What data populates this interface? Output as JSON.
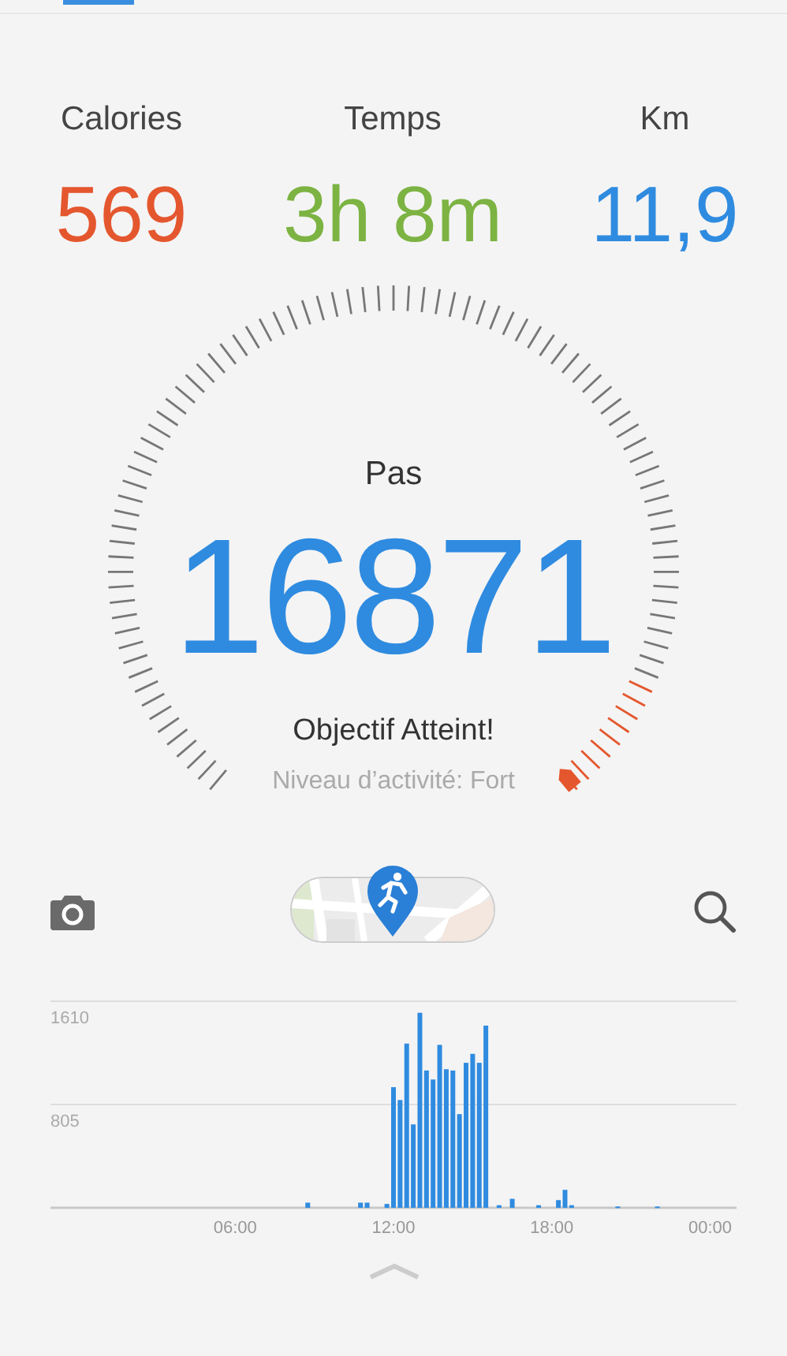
{
  "stats": [
    {
      "label": "Calories",
      "value": "569",
      "color": "#e4572e"
    },
    {
      "label": "Temps",
      "value": "3h 8m",
      "color": "#7cb342"
    },
    {
      "label": "Km",
      "value": "11,9",
      "color": "#2f8be0"
    }
  ],
  "gauge": {
    "label": "Pas",
    "value": "16871",
    "status": "Objectif Atteint!",
    "activity": "Niveau d’activité: Fort"
  },
  "chart": {
    "chart_data": {
      "type": "bar",
      "xlim": [
        -1,
        25
      ],
      "ylim": [
        0,
        1610
      ],
      "x": [
        8.75,
        10.75,
        11.0,
        11.75,
        12.0,
        12.25,
        12.5,
        12.75,
        13.0,
        13.25,
        13.5,
        13.75,
        14.0,
        14.25,
        14.5,
        14.75,
        15.0,
        15.25,
        15.5,
        16.0,
        16.5,
        17.5,
        18.25,
        18.5,
        18.75,
        20.5,
        22.0
      ],
      "values": [
        40,
        40,
        40,
        30,
        940,
        840,
        1280,
        650,
        1520,
        1070,
        1000,
        1270,
        1080,
        1070,
        730,
        1130,
        1200,
        1130,
        1420,
        20,
        70,
        20,
        60,
        140,
        20,
        10,
        10
      ],
      "xticks": [
        {
          "value": 6,
          "label": "06:00"
        },
        {
          "value": 12,
          "label": "12:00"
        },
        {
          "value": 18,
          "label": "18:00"
        },
        {
          "value": 24,
          "label": "00:00"
        }
      ],
      "yticks": [
        {
          "value": 805,
          "label": "805"
        },
        {
          "value": 1610,
          "label": "1610"
        }
      ]
    }
  }
}
